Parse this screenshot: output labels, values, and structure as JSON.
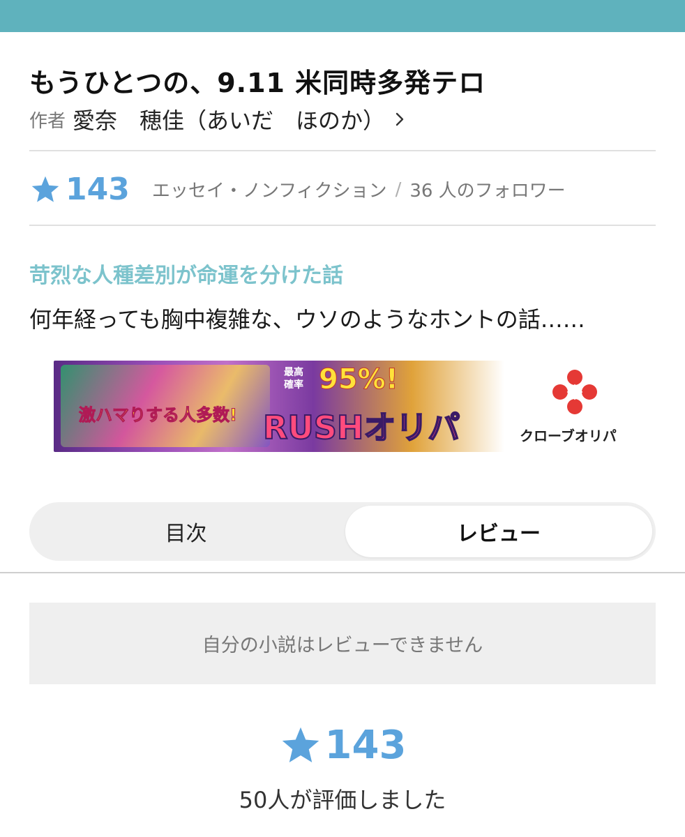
{
  "header": {
    "bar_color": "#5fb2bd"
  },
  "work": {
    "title": "もうひとつの、9.11 米同時多発テロ",
    "author_prefix": "作者",
    "author_name": "愛奈　穂佳（あいだ　ほのか）",
    "rating": "143",
    "genre": "エッセイ・ノンフィクション",
    "separator": "/",
    "followers": "36 人のフォロワー",
    "catchphrase": "苛烈な人種差別が命運を分けた話",
    "description": "何年経っても胸中複雑な、ウソのようなホントの話……"
  },
  "ad": {
    "text_left": "激ハマりする人多数!",
    "text_small": "最高\n確率",
    "text_percent": "95%!",
    "text_main": "RUSHオリパ",
    "brand": "クローブオリパ"
  },
  "tabs": [
    {
      "label": "目次",
      "active": false
    },
    {
      "label": "レビュー",
      "active": true
    }
  ],
  "review": {
    "notice": "自分の小説はレビューできません",
    "rating": "143",
    "rated_count": "50人が評価しました"
  },
  "colors": {
    "accent_blue": "#5ba3dc",
    "catch_teal": "#7cc3cc",
    "muted_text": "#777777"
  }
}
